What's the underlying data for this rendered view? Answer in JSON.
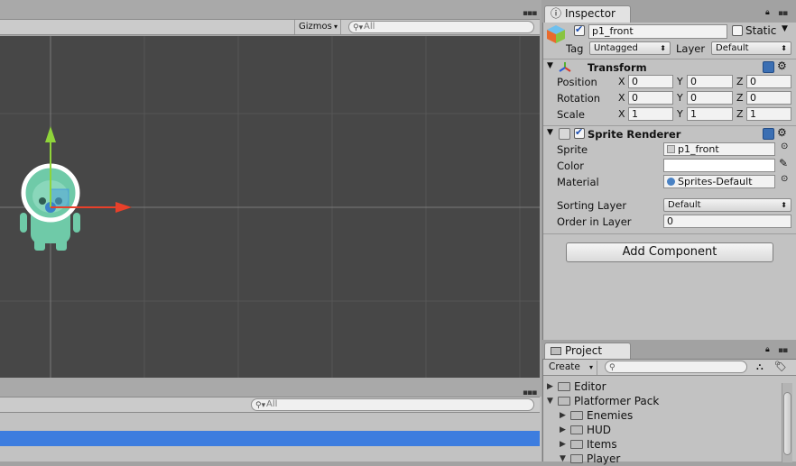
{
  "scene": {
    "gizmos_label": "Gizmos",
    "search_placeholder": "All"
  },
  "hierarchy": {
    "search_placeholder": "All"
  },
  "inspector": {
    "tab_label": "Inspector",
    "object_name": "p1_front",
    "static_label": "Static",
    "tag_label": "Tag",
    "tag_value": "Untagged",
    "layer_label": "Layer",
    "layer_value": "Default",
    "transform": {
      "title": "Transform",
      "position_label": "Position",
      "rotation_label": "Rotation",
      "scale_label": "Scale",
      "x": "X",
      "y": "Y",
      "z": "Z",
      "position": [
        "0",
        "0",
        "0"
      ],
      "rotation": [
        "0",
        "0",
        "0"
      ],
      "scale": [
        "1",
        "1",
        "1"
      ]
    },
    "sprite_renderer": {
      "title": "Sprite Renderer",
      "sprite_label": "Sprite",
      "sprite_value": "p1_front",
      "color_label": "Color",
      "material_label": "Material",
      "material_value": "Sprites-Default",
      "sorting_layer_label": "Sorting Layer",
      "sorting_layer_value": "Default",
      "order_label": "Order in Layer",
      "order_value": "0"
    },
    "add_component_label": "Add Component"
  },
  "project": {
    "tab_label": "Project",
    "create_label": "Create",
    "folders": [
      {
        "name": "Editor",
        "depth": 0,
        "expanded": false
      },
      {
        "name": "Platformer Pack",
        "depth": 0,
        "expanded": true
      },
      {
        "name": "Enemies",
        "depth": 1,
        "expanded": false
      },
      {
        "name": "HUD",
        "depth": 1,
        "expanded": false
      },
      {
        "name": "Items",
        "depth": 1,
        "expanded": false
      },
      {
        "name": "Player",
        "depth": 1,
        "expanded": true
      }
    ]
  },
  "colors": {
    "selection": "#3d7ddf",
    "scene_bg": "#474747",
    "panel_bg": "#c2c2c2",
    "axis_x": "#e8402a",
    "axis_y": "#8fd43a"
  }
}
